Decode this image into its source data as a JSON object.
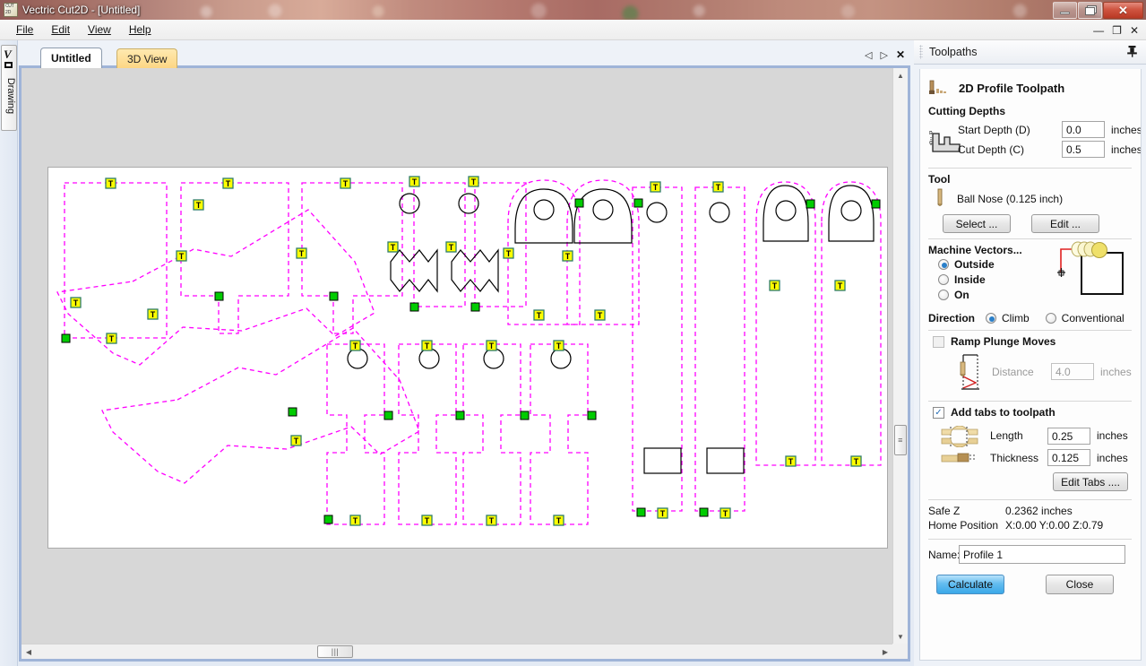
{
  "window": {
    "title": "Vectric Cut2D - [Untitled]",
    "app_icon": "cut2d-app-icon",
    "minimize_label": "",
    "restore_label": "",
    "close_label": "✕"
  },
  "menubar": {
    "items": [
      {
        "label": "File",
        "accel": "F"
      },
      {
        "label": "Edit",
        "accel": "E"
      },
      {
        "label": "View",
        "accel": "V"
      },
      {
        "label": "Help",
        "accel": "H"
      }
    ]
  },
  "mdi_controls": {
    "minimize": "—",
    "restore": "❐",
    "close": "✕"
  },
  "left_rail": {
    "drawing_tab_label": "Drawing",
    "drawing_tab_icon": "pen-and-rect-icon"
  },
  "document": {
    "tabs": [
      {
        "label": "Untitled",
        "active": true
      },
      {
        "label": "3D View",
        "active": false
      }
    ],
    "tab_nav": {
      "prev": "◁",
      "next": "▷",
      "close": "✕"
    }
  },
  "scrollbars": {
    "v_up": "▲",
    "v_down": "▼",
    "h_left": "◀",
    "h_right": "▶",
    "h_thumb_grip": "|||",
    "v_thumb_grip": "≡"
  },
  "panel": {
    "title": "Toolpaths",
    "pin_icon": "pushpin-icon",
    "heading": "2D Profile Toolpath",
    "heading_icon": "profile-toolpath-icon",
    "cutting_depths": {
      "section_label": "Cutting Depths",
      "icon": "cut-depth-diagram-icon",
      "start_depth_label": "Start Depth (D)",
      "start_depth_value": "0.0",
      "start_depth_unit": "inches",
      "cut_depth_label": "Cut Depth (C)",
      "cut_depth_value": "0.5",
      "cut_depth_unit": "inches"
    },
    "tool": {
      "section_label": "Tool",
      "icon": "end-mill-icon",
      "name": "Ball Nose (0.125 inch)",
      "select_button": "Select ...",
      "edit_button": "Edit ..."
    },
    "machine_vectors": {
      "section_label": "Machine Vectors...",
      "diagram_icon": "machine-vectors-outside-diagram",
      "options": [
        {
          "label": "Outside",
          "selected": true
        },
        {
          "label": "Inside",
          "selected": false
        },
        {
          "label": "On",
          "selected": false
        }
      ]
    },
    "direction": {
      "label": "Direction",
      "options": [
        {
          "label": "Climb",
          "selected": true
        },
        {
          "label": "Conventional",
          "selected": false
        }
      ]
    },
    "ramp_plunge": {
      "checkbox_label": "Ramp Plunge Moves",
      "checked": false,
      "icon": "ramp-plunge-diagram-icon",
      "distance_label": "Distance",
      "distance_value": "4.0",
      "distance_unit": "inches"
    },
    "tabs_section": {
      "checkbox_label": "Add tabs to toolpath",
      "checked": true,
      "length_icon": "tab-length-icon",
      "length_label": "Length",
      "length_value": "0.25",
      "length_unit": "inches",
      "thickness_icon": "tab-thickness-icon",
      "thickness_label": "Thickness",
      "thickness_value": "0.125",
      "thickness_unit": "inches",
      "edit_tabs_button": "Edit Tabs ...."
    },
    "positions": {
      "safe_z_label": "Safe Z",
      "safe_z_value": "0.2362 inches",
      "home_label": "Home Position",
      "home_value": "X:0.00 Y:0.00 Z:0.79"
    },
    "name": {
      "label": "Name:",
      "value": "Profile 1"
    },
    "actions": {
      "calculate": "Calculate",
      "close": "Close"
    }
  },
  "colors": {
    "toolpath": "#ff00ff",
    "vector": "#000000",
    "tab_marker_fill": "#ffff00",
    "tab_marker_border": "#2e7d6b",
    "start_point": "#00cc00",
    "accent": "#3aa8e8",
    "active_tab": "#ffffff",
    "inactive_tab": "#fcd684"
  },
  "canvas": {
    "tab_marker_letter": "T",
    "shapes": [
      {
        "name": "blank-panel-1",
        "type": "rect-path"
      },
      {
        "name": "notched-panel-2",
        "type": "rect-path"
      },
      {
        "name": "notched-panel-3",
        "type": "rect-path"
      },
      {
        "name": "zigzag-panel-4",
        "type": "zigzag"
      },
      {
        "name": "zigzag-panel-5",
        "type": "zigzag"
      },
      {
        "name": "arch-head-6",
        "type": "arch"
      },
      {
        "name": "arch-head-7",
        "type": "arch"
      },
      {
        "name": "circle-strip-8",
        "type": "strip"
      },
      {
        "name": "circle-strip-9",
        "type": "strip"
      },
      {
        "name": "arch-strip-10",
        "type": "arch-strip"
      },
      {
        "name": "arch-strip-11",
        "type": "arch-strip"
      },
      {
        "name": "organic-poly-12",
        "type": "polygon"
      },
      {
        "name": "organic-poly-13",
        "type": "polygon"
      },
      {
        "name": "leg-panel-14",
        "type": "leg"
      },
      {
        "name": "leg-panel-15",
        "type": "leg"
      },
      {
        "name": "leg-panel-16",
        "type": "leg"
      },
      {
        "name": "leg-panel-17",
        "type": "leg"
      },
      {
        "name": "box-strip-18",
        "type": "box-strip"
      },
      {
        "name": "box-strip-19",
        "type": "box-strip"
      }
    ]
  }
}
